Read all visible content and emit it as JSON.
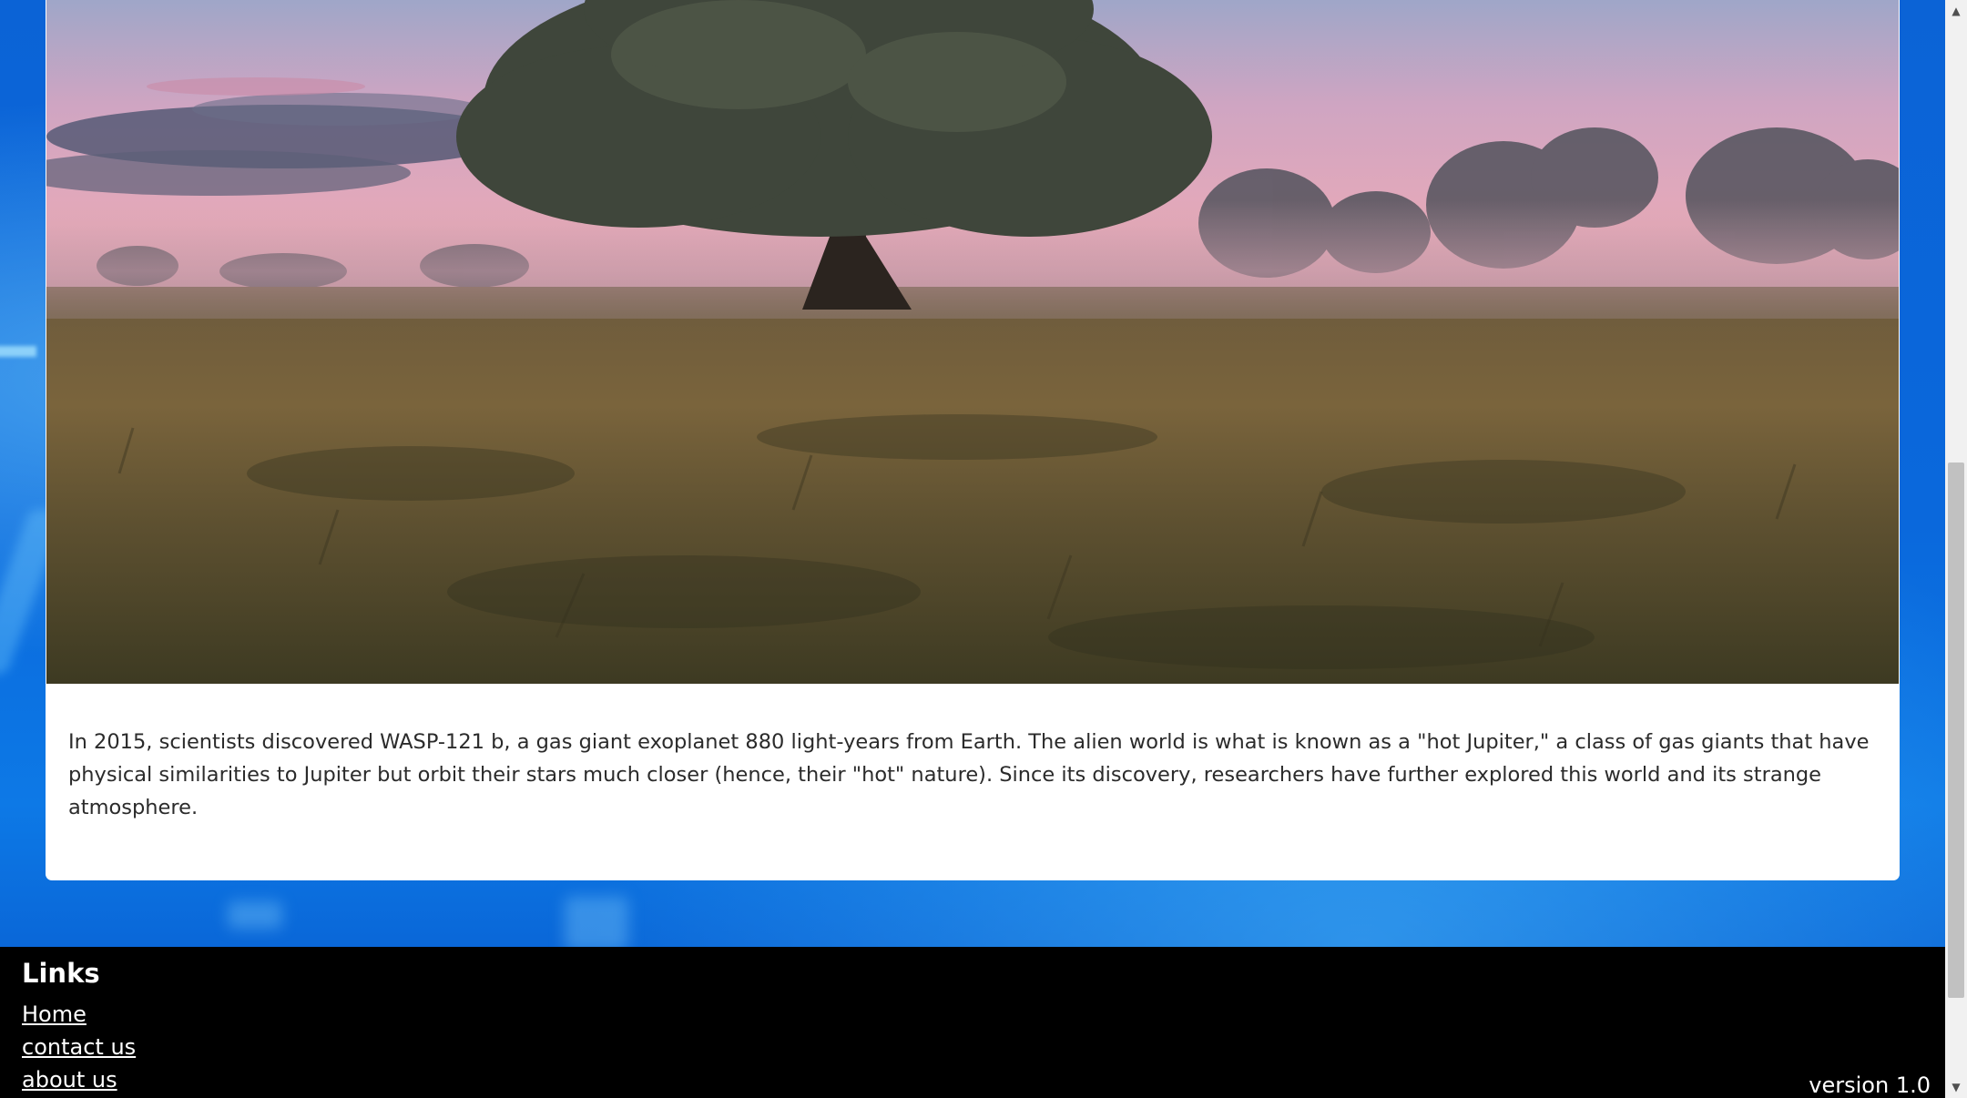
{
  "article": {
    "image_alt": "Tree in a misty wheat field at sunset",
    "text": "In 2015, scientists discovered WASP-121 b, a gas giant exoplanet 880 light-years from Earth. The alien world is what is known as a \"hot Jupiter,\" a class of gas giants that have physical similarities to Jupiter but orbit their stars much closer (hence, their \"hot\" nature). Since its discovery, researchers have further explored this world and its strange atmosphere."
  },
  "footer": {
    "heading": "Links",
    "links": [
      {
        "label": "Home"
      },
      {
        "label": "contact us"
      },
      {
        "label": "about us"
      }
    ],
    "version": "version 1.0"
  },
  "icons": {
    "scroll_up": "chevron-up-icon",
    "scroll_down": "chevron-down-icon"
  },
  "colors": {
    "background": "#0a68dc",
    "footer": "#000000",
    "card": "#ffffff"
  }
}
